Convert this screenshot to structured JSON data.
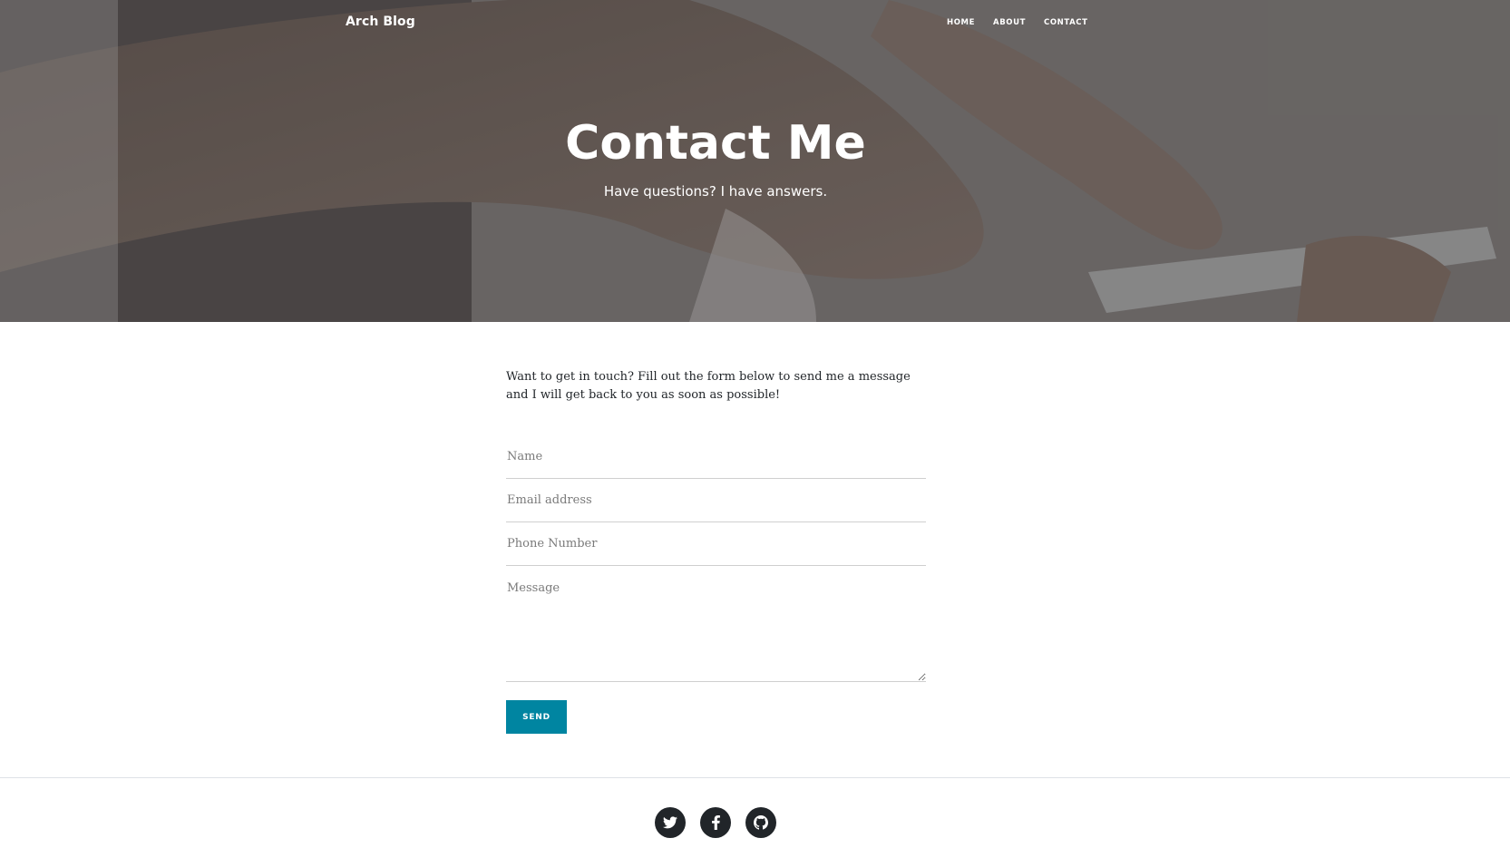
{
  "navbar": {
    "brand": "Arch Blog",
    "links": [
      {
        "label": "HOME"
      },
      {
        "label": "ABOUT"
      },
      {
        "label": "CONTACT"
      }
    ]
  },
  "hero": {
    "title": "Contact Me",
    "subtitle": "Have questions? I have answers."
  },
  "main": {
    "intro": "Want to get in touch? Fill out the form below to send me a message and I will get back to you as soon as possible!",
    "form": {
      "name_placeholder": "Name",
      "email_placeholder": "Email address",
      "phone_placeholder": "Phone Number",
      "message_placeholder": "Message",
      "send_label": "SEND"
    }
  },
  "footer": {
    "social": [
      {
        "icon": "twitter-icon"
      },
      {
        "icon": "facebook-icon"
      },
      {
        "icon": "github-icon"
      }
    ]
  },
  "colors": {
    "accent": "#0085a1",
    "social_bg": "#212529",
    "text": "#212529"
  }
}
